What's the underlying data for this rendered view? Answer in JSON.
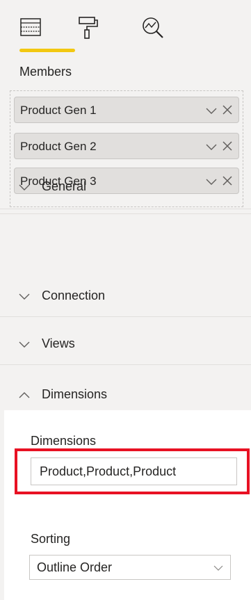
{
  "toolbar": {
    "tabs": [
      {
        "icon": "fields-grid-icon",
        "active": true
      },
      {
        "icon": "paint-roller-icon",
        "active": false
      },
      {
        "icon": "analytics-magnifier-icon",
        "active": false
      }
    ],
    "active_underline_color": "#f2c811"
  },
  "members": {
    "label": "Members",
    "items": [
      {
        "label": "Product Gen 1"
      },
      {
        "label": "Product Gen 2"
      },
      {
        "label": "Product Gen 3"
      }
    ]
  },
  "format": {
    "sections": [
      {
        "label": "General",
        "expanded": false
      },
      {
        "label": "Connection",
        "expanded": false
      },
      {
        "label": "Views",
        "expanded": false
      },
      {
        "label": "Dimensions",
        "expanded": true
      }
    ],
    "dimensions_field": {
      "label": "Dimensions",
      "value": "Product,Product,Product",
      "highlight_color": "#e81123"
    },
    "sorting_field": {
      "label": "Sorting",
      "selected": "Outline Order"
    }
  }
}
